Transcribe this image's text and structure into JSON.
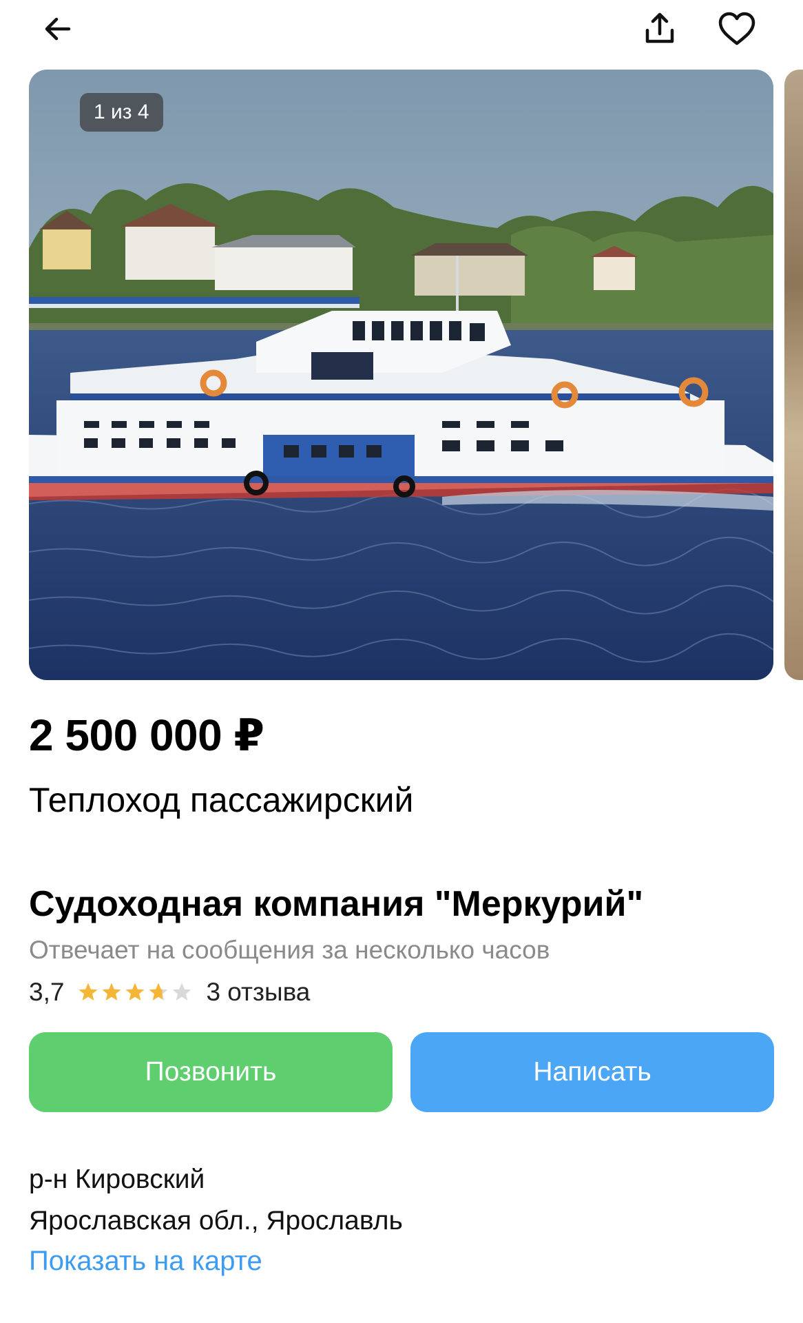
{
  "photo": {
    "counter": "1 из 4"
  },
  "listing": {
    "price": "2 500 000 ₽",
    "title": "Теплоход пассажирский"
  },
  "seller": {
    "name": "Судоходная компания \"Меркурий\"",
    "response": "Отвечает на сообщения за несколько часов",
    "rating": "3,7",
    "rating_value": 3.7,
    "stars_max": 5,
    "reviews": "3 отзыва"
  },
  "actions": {
    "call": "Позвонить",
    "write": "Написать"
  },
  "location": {
    "district": "р-н Кировский",
    "region": "Ярославская обл., Ярославль",
    "map_link": "Показать на карте"
  },
  "colors": {
    "call_button": "#5fce6f",
    "write_button": "#4ca6f6",
    "link": "#3d9bf0",
    "star_filled": "#f5b536",
    "star_empty": "#d9d9d9"
  },
  "icons": [
    "back-arrow-icon",
    "share-icon",
    "heart-icon",
    "star-icon"
  ]
}
